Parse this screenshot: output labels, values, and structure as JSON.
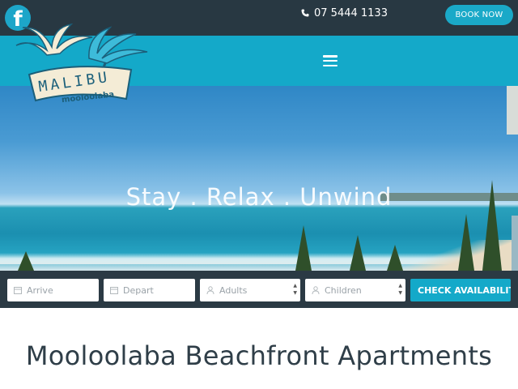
{
  "header": {
    "facebook_icon": "facebook-icon",
    "phone_icon": "phone-icon",
    "phone": "07 5444 1133",
    "book_now": "BOOK NOW"
  },
  "logo": {
    "brand": "MALIBU",
    "location": "mooloolaba"
  },
  "nav": {
    "menu_icon": "hamburger-menu-icon"
  },
  "hero": {
    "tagline": "Stay . Relax . Unwind"
  },
  "booking": {
    "arrive_placeholder": "Arrive",
    "depart_placeholder": "Depart",
    "adults_placeholder": "Adults",
    "children_placeholder": "Children",
    "check_label": "CHECK AVAILABILITY"
  },
  "main": {
    "heading": "Mooloolaba Beachfront Apartments"
  },
  "colors": {
    "topbar": "#283842",
    "accent": "#14a9c9",
    "searchbar": "#2b3a44"
  }
}
